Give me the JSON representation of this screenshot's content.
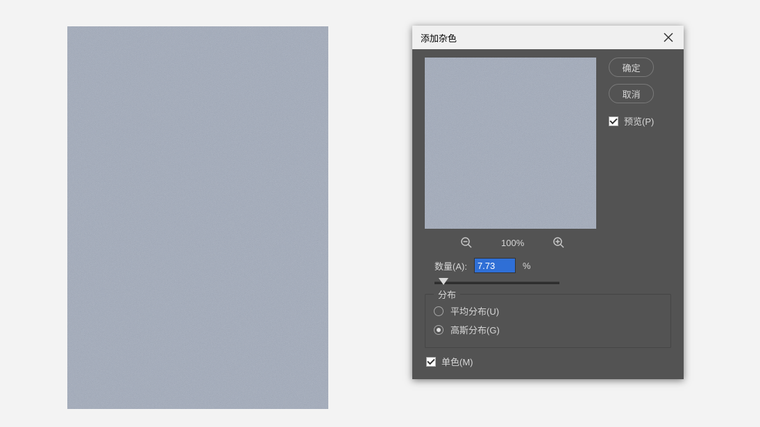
{
  "dialog": {
    "title": "添加杂色",
    "ok_label": "确定",
    "cancel_label": "取消",
    "preview_label": "预览(P)",
    "preview_checked": true,
    "zoom_level": "100%",
    "amount": {
      "label": "数量(A):",
      "value": "7.73",
      "unit": "%",
      "slider_pct": 7.73
    },
    "distribution": {
      "legend": "分布",
      "options": [
        {
          "label": "平均分布(U)",
          "value": "uniform",
          "selected": false
        },
        {
          "label": "高斯分布(G)",
          "value": "gaussian",
          "selected": true
        }
      ]
    },
    "monochrome": {
      "label": "单色(M)",
      "checked": true
    }
  }
}
